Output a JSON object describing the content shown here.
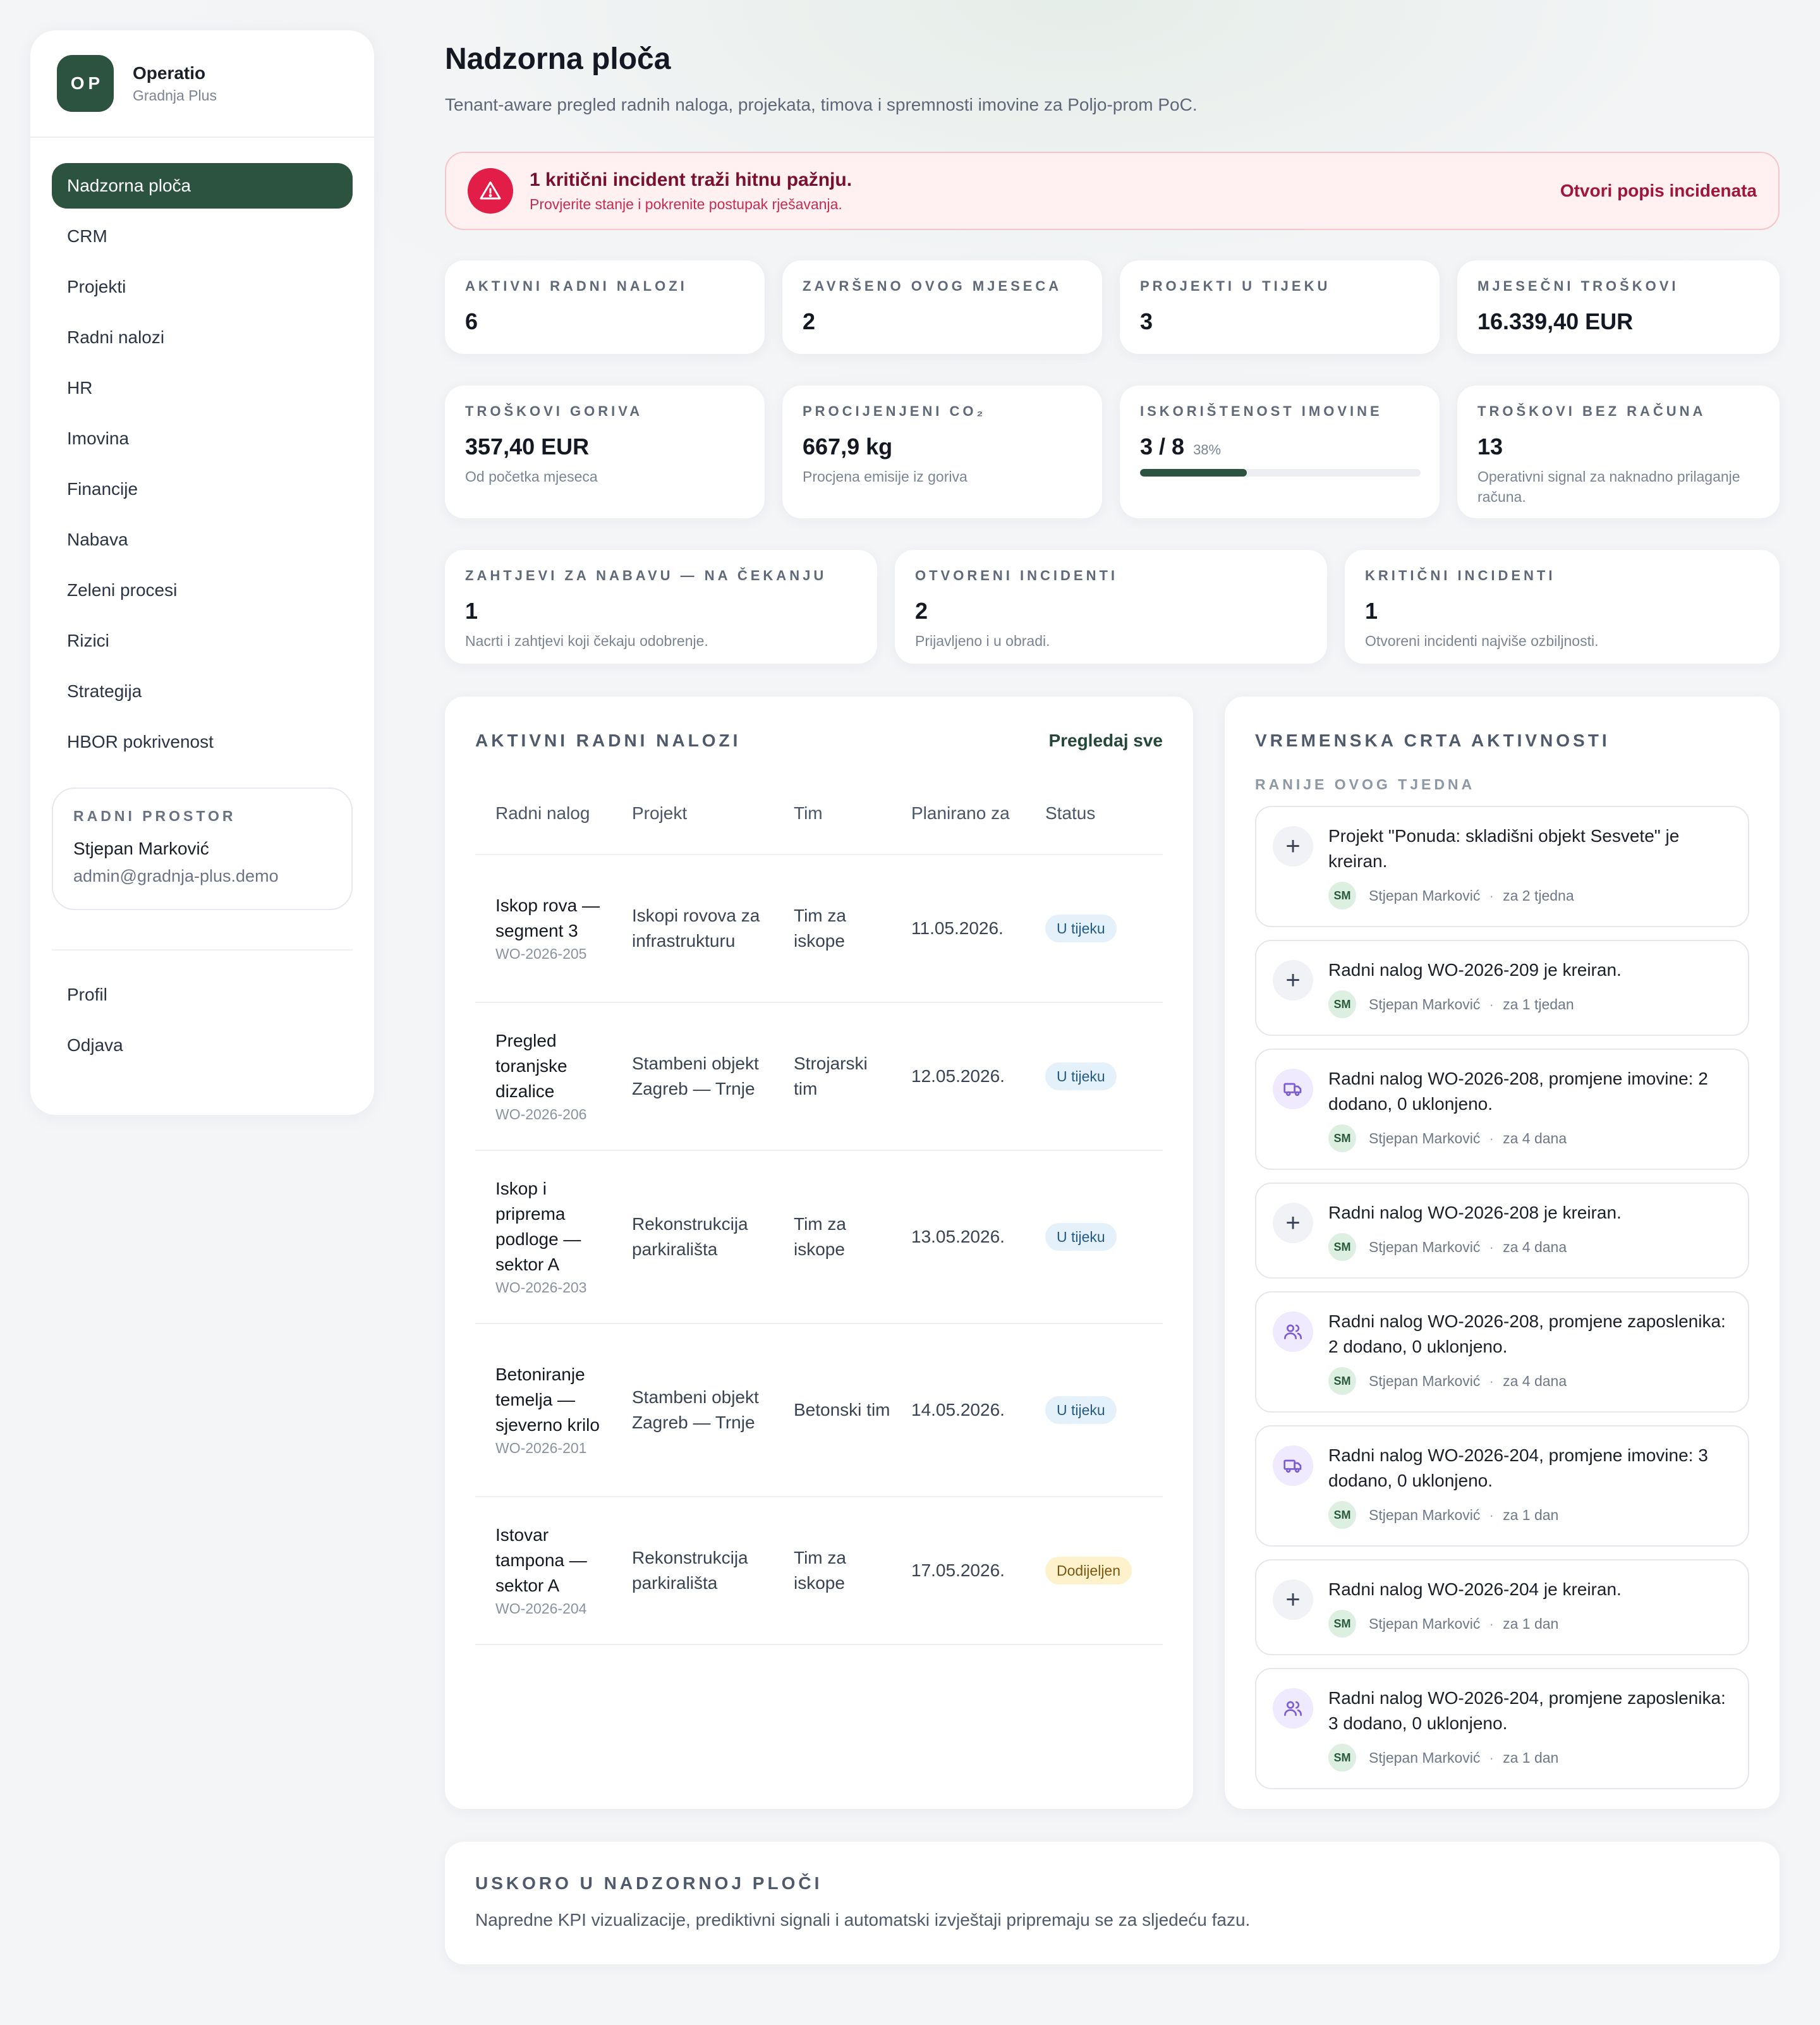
{
  "brand": {
    "logo": "OP",
    "name": "Operatio",
    "sub": "Gradnja Plus"
  },
  "nav": {
    "items": [
      {
        "label": "Nadzorna ploča",
        "active": true
      },
      {
        "label": "CRM"
      },
      {
        "label": "Projekti"
      },
      {
        "label": "Radni nalozi"
      },
      {
        "label": "HR"
      },
      {
        "label": "Imovina"
      },
      {
        "label": "Financije"
      },
      {
        "label": "Nabava"
      },
      {
        "label": "Zeleni procesi"
      },
      {
        "label": "Rizici"
      },
      {
        "label": "Strategija"
      },
      {
        "label": "HBOR pokrivenost"
      }
    ],
    "bottom": [
      {
        "label": "Profil"
      },
      {
        "label": "Odjava"
      }
    ]
  },
  "workspace": {
    "label": "RADNI PROSTOR",
    "name": "Stjepan Marković",
    "email": "admin@gradnja-plus.demo"
  },
  "header": {
    "title": "Nadzorna ploča",
    "subtitle": "Tenant-aware pregled radnih naloga, projekata, timova i spremnosti imovine za Poljo-prom PoC."
  },
  "alert": {
    "icon": "warning-triangle-icon",
    "title": "1 kritični incident traži hitnu pažnju.",
    "desc": "Provjerite stanje i pokrenite postupak rješavanja.",
    "link": "Otvori popis incidenata"
  },
  "kpis_row1": [
    {
      "label": "AKTIVNI RADNI NALOZI",
      "value": "6"
    },
    {
      "label": "ZAVRŠENO OVOG MJESECA",
      "value": "2"
    },
    {
      "label": "PROJEKTI U TIJEKU",
      "value": "3"
    },
    {
      "label": "MJESEČNI TROŠKOVI",
      "value": "16.339,40 EUR"
    }
  ],
  "kpis_row2": [
    {
      "label": "TROŠKOVI GORIVA",
      "value": "357,40 EUR",
      "desc": "Od početka mjeseca"
    },
    {
      "label": "PROCIJENJENI CO₂",
      "value": "667,9 kg",
      "desc": "Procjena emisije iz goriva"
    },
    {
      "label": "ISKORIŠTENOST IMOVINE",
      "value": "3 / 8",
      "pct": "38%",
      "fraction": 0.38
    },
    {
      "label": "TROŠKOVI BEZ RAČUNA",
      "value": "13",
      "desc": "Operativni signal za naknadno prilaganje računa."
    }
  ],
  "kpis_row3": [
    {
      "label": "ZAHTJEVI ZA NABAVU — NA ČEKANJU",
      "value": "1",
      "desc": "Nacrti i zahtjevi koji čekaju odobrenje."
    },
    {
      "label": "OTVORENI INCIDENTI",
      "value": "2",
      "desc": "Prijavljeno i u obradi."
    },
    {
      "label": "KRITIČNI INCIDENTI",
      "value": "1",
      "desc": "Otvoreni incidenti najviše ozbiljnosti."
    }
  ],
  "work_orders": {
    "title": "AKTIVNI RADNI NALOZI",
    "link": "Pregledaj sve",
    "columns": [
      "Radni nalog",
      "Projekt",
      "Tim",
      "Planirano za",
      "Status"
    ],
    "rows": [
      {
        "name": "Iskop rova — segment 3",
        "code": "WO-2026-205",
        "project": "Iskopi rovova za infrastrukturu",
        "team": "Tim za iskope",
        "date": "11.05.2026.",
        "status": "U tijeku",
        "status_kind": "progress"
      },
      {
        "name": "Pregled toranjske dizalice",
        "code": "WO-2026-206",
        "project": "Stambeni objekt Zagreb — Trnje",
        "team": "Strojarski tim",
        "date": "12.05.2026.",
        "status": "U tijeku",
        "status_kind": "progress"
      },
      {
        "name": "Iskop i priprema podloge — sektor A",
        "code": "WO-2026-203",
        "project": "Rekonstrukcija parkirališta",
        "team": "Tim za iskope",
        "date": "13.05.2026.",
        "status": "U tijeku",
        "status_kind": "progress"
      },
      {
        "name": "Betoniranje temelja — sjeverno krilo",
        "code": "WO-2026-201",
        "project": "Stambeni objekt Zagreb — Trnje",
        "team": "Betonski tim",
        "date": "14.05.2026.",
        "status": "U tijeku",
        "status_kind": "progress"
      },
      {
        "name": "Istovar tampona — sektor A",
        "code": "WO-2026-204",
        "project": "Rekonstrukcija parkirališta",
        "team": "Tim za iskope",
        "date": "17.05.2026.",
        "status": "Dodijeljen",
        "status_kind": "assigned"
      }
    ]
  },
  "timeline": {
    "title": "VREMENSKA CRTA AKTIVNOSTI",
    "subtitle": "RANIJE OVOG TJEDNA",
    "items": [
      {
        "icon": "plus-icon",
        "text": "Projekt \"Ponuda: skladišni objekt Sesvete\" je kreiran.",
        "initials": "SM",
        "user": "Stjepan Marković",
        "when": "za 2 tjedna"
      },
      {
        "icon": "plus-icon",
        "text": "Radni nalog WO-2026-209 je kreiran.",
        "initials": "SM",
        "user": "Stjepan Marković",
        "when": "za 1 tjedan"
      },
      {
        "icon": "truck-icon",
        "text": "Radni nalog WO-2026-208, promjene imovine: 2 dodano, 0 uklonjeno.",
        "initials": "SM",
        "user": "Stjepan Marković",
        "when": "za 4 dana"
      },
      {
        "icon": "plus-icon",
        "text": "Radni nalog WO-2026-208 je kreiran.",
        "initials": "SM",
        "user": "Stjepan Marković",
        "when": "za 4 dana"
      },
      {
        "icon": "users-icon",
        "text": "Radni nalog WO-2026-208, promjene zaposlenika: 2 dodano, 0 uklonjeno.",
        "initials": "SM",
        "user": "Stjepan Marković",
        "when": "za 4 dana"
      },
      {
        "icon": "truck-icon",
        "text": "Radni nalog WO-2026-204, promjene imovine: 3 dodano, 0 uklonjeno.",
        "initials": "SM",
        "user": "Stjepan Marković",
        "when": "za 1 dan"
      },
      {
        "icon": "plus-icon",
        "text": "Radni nalog WO-2026-204 je kreiran.",
        "initials": "SM",
        "user": "Stjepan Marković",
        "when": "za 1 dan"
      },
      {
        "icon": "users-icon",
        "text": "Radni nalog WO-2026-204, promjene zaposlenika: 3 dodano, 0 uklonjeno.",
        "initials": "SM",
        "user": "Stjepan Marković",
        "when": "za 1 dan"
      }
    ]
  },
  "soon": {
    "title": "USKORO U NADZORNOJ PLOČI",
    "text": "Napredne KPI vizualizacije, prediktivni signali i automatski izvještaji pripremaju se za sljedeću fazu."
  },
  "colors": {
    "brand": "#2c5240",
    "alert_bg": "#fff0f1",
    "alert_icon": "#e11d48",
    "status_progress_bg": "#e4f1fb",
    "status_assigned_bg": "#fdf2cc",
    "timeline_icon_accent": "#7c5cd6"
  }
}
